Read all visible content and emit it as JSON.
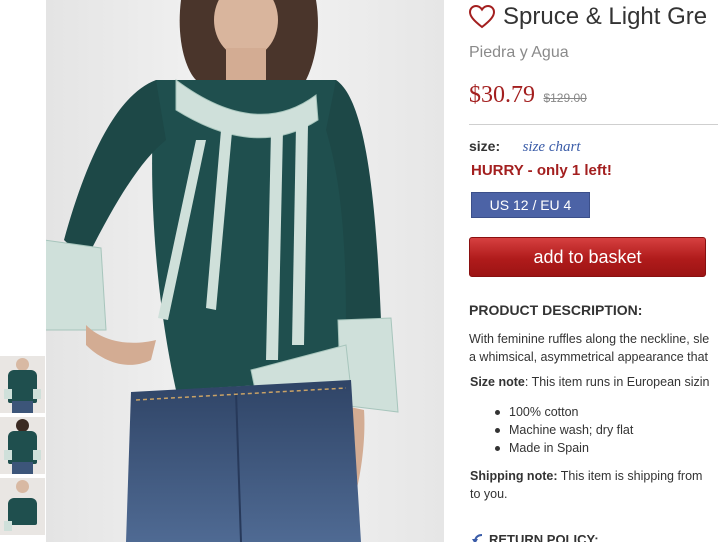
{
  "product": {
    "title": "Spruce & Light Gre",
    "brand": "Piedra y Agua",
    "price": "$30.79",
    "original_price": "$129.00"
  },
  "size": {
    "label": "size:",
    "chart_link": "size chart",
    "stock_warning": "HURRY - only 1 left!",
    "options": [
      "US 12 / EU 4"
    ]
  },
  "actions": {
    "add_to_basket": "add to basket"
  },
  "description": {
    "heading": "PRODUCT DESCRIPTION:",
    "lines": [
      "With feminine ruffles along the neckline, sle",
      "a whimsical, asymmetrical appearance that"
    ],
    "size_note_label": "Size note",
    "size_note_text": ": This item runs in European sizin",
    "features": [
      "100% cotton",
      "Machine wash; dry flat",
      "Made in Spain"
    ],
    "shipping_note_label": "Shipping note:",
    "shipping_note_lines": [
      " This item is shipping from",
      "to you."
    ],
    "return_policy": "RETURN POLICY:"
  },
  "icons": {
    "favorite": "heart-outline-icon",
    "return": "return-arrow-icon"
  },
  "colors": {
    "price_red": "#a31f1f",
    "size_button": "#4c63a6",
    "basket_button": "#b01b1b",
    "link_blue": "#3a5ca8",
    "top_color": "#1f4f4e"
  },
  "gallery": {
    "thumbnail_count": 3
  }
}
